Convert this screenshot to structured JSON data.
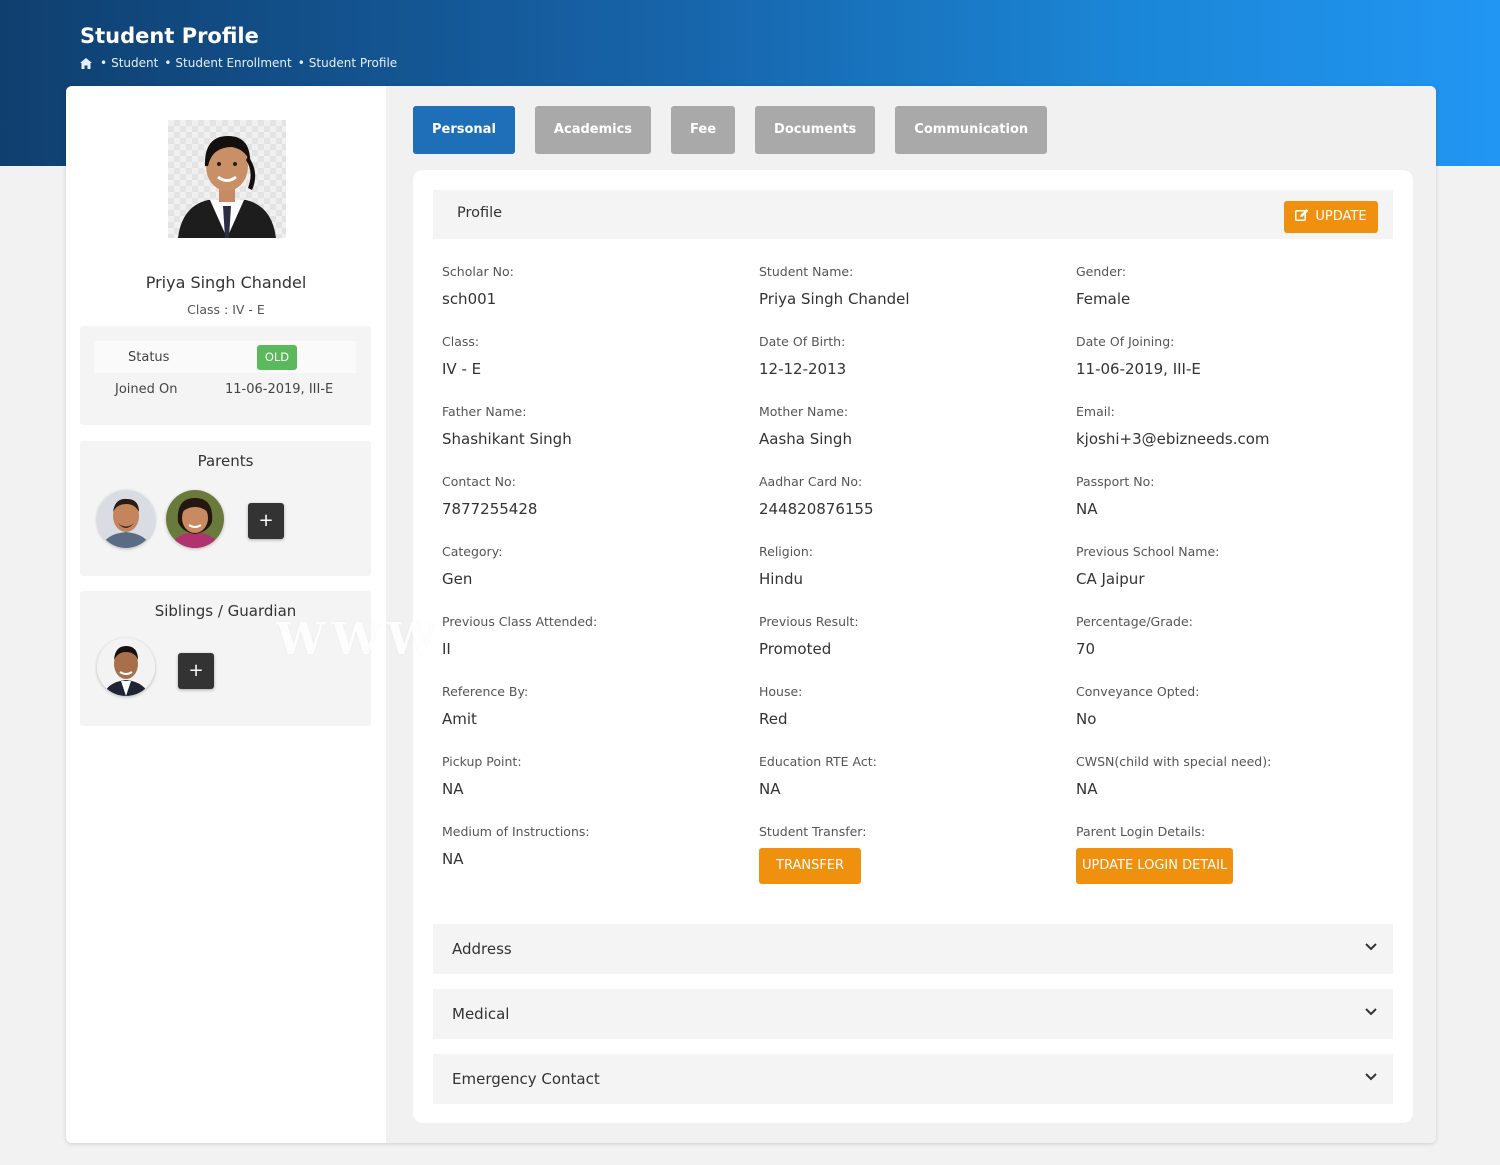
{
  "header": {
    "title": "Student Profile",
    "breadcrumb": [
      "Student",
      "Student Enrollment",
      "Student Profile"
    ]
  },
  "sidebar": {
    "student_name": "Priya Singh Chandel",
    "student_class": "Class : IV - E",
    "status_label": "Status",
    "status_badge": "OLD",
    "joined_label": "Joined On",
    "joined_value": "11-06-2019, III-E",
    "parents_title": "Parents",
    "siblings_title": "Siblings / Guardian",
    "add_label": "+"
  },
  "tabs": [
    "Personal",
    "Academics",
    "Fee",
    "Documents",
    "Communication"
  ],
  "profile": {
    "title": "Profile",
    "update_label": "UPDATE",
    "fields": [
      {
        "label": "Scholar No:",
        "value": "sch001"
      },
      {
        "label": "Student Name:",
        "value": "Priya Singh Chandel"
      },
      {
        "label": "Gender:",
        "value": "Female"
      },
      {
        "label": "Class:",
        "value": "IV - E"
      },
      {
        "label": "Date Of Birth:",
        "value": "12-12-2013"
      },
      {
        "label": "Date Of Joining:",
        "value": "11-06-2019, III-E"
      },
      {
        "label": "Father Name:",
        "value": "Shashikant Singh"
      },
      {
        "label": "Mother Name:",
        "value": "Aasha Singh"
      },
      {
        "label": "Email:",
        "value": "kjoshi+3@ebizneeds.com"
      },
      {
        "label": "Contact No:",
        "value": "7877255428"
      },
      {
        "label": "Aadhar Card No:",
        "value": "244820876155"
      },
      {
        "label": "Passport No:",
        "value": "NA"
      },
      {
        "label": "Category:",
        "value": "Gen"
      },
      {
        "label": "Religion:",
        "value": "Hindu"
      },
      {
        "label": "Previous School Name:",
        "value": "CA Jaipur"
      },
      {
        "label": "Previous Class Attended:",
        "value": "II"
      },
      {
        "label": "Previous Result:",
        "value": "Promoted"
      },
      {
        "label": "Percentage/Grade:",
        "value": "70"
      },
      {
        "label": "Reference By:",
        "value": "Amit"
      },
      {
        "label": "House:",
        "value": "Red"
      },
      {
        "label": "Conveyance Opted:",
        "value": "No"
      },
      {
        "label": "Pickup Point:",
        "value": "NA"
      },
      {
        "label": "Education RTE Act:",
        "value": "NA"
      },
      {
        "label": "CWSN(child with special need):",
        "value": "NA"
      },
      {
        "label": "Medium of Instructions:",
        "value": "NA"
      },
      {
        "label": "Student Transfer:",
        "button": "TRANSFER"
      },
      {
        "label": "Parent Login Details:",
        "button": "UPDATE LOGIN DETAIL"
      }
    ]
  },
  "sections": [
    "Address",
    "Medical",
    "Emergency Contact"
  ],
  "watermark": "WWW",
  "colors": {
    "header_gradient_start": "#0f3f6f",
    "header_gradient_end": "#2196f3",
    "tab_active": "#1e6fb8",
    "tab_inactive": "#a9a9a9",
    "accent_orange": "#f0900f",
    "badge_green": "#5cb85c"
  },
  "icons": [
    "home-icon",
    "edit-icon",
    "chevron-down-icon",
    "plus-icon"
  ]
}
